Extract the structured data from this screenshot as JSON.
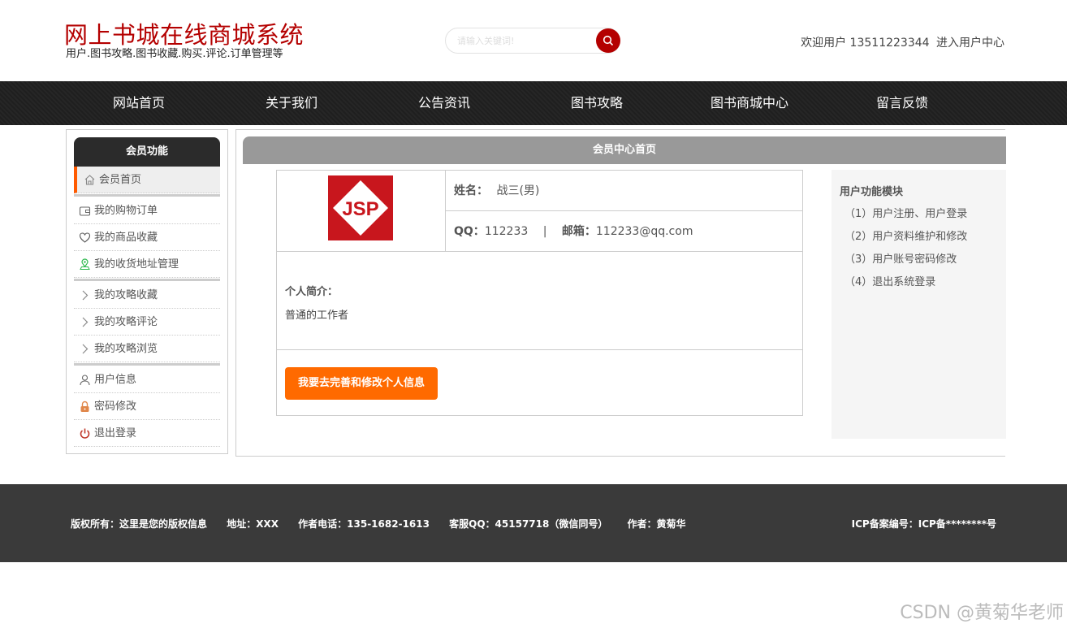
{
  "header": {
    "title": "网上书城在线商城系统",
    "subtitle": "用户.图书攻略.图书收藏.购买.评论.订单管理等",
    "search_placeholder": "请输入关键词!",
    "welcome_text": "欢迎用户 13511223344",
    "user_center_link": "进入用户中心"
  },
  "nav": {
    "items": [
      "网站首页",
      "关于我们",
      "公告资讯",
      "图书攻略",
      "图书商城中心",
      "留言反馈"
    ]
  },
  "sidebar": {
    "title": "会员功能",
    "items": [
      {
        "label": "会员首页",
        "icon": "home-icon"
      },
      {
        "label": "我的购物订单",
        "icon": "wallet-icon"
      },
      {
        "label": "我的商品收藏",
        "icon": "heart-icon"
      },
      {
        "label": "我的收货地址管理",
        "icon": "location-icon"
      },
      {
        "label": "我的攻略收藏",
        "icon": "chevron-right-icon"
      },
      {
        "label": "我的攻略评论",
        "icon": "chevron-right-icon"
      },
      {
        "label": "我的攻略浏览",
        "icon": "chevron-right-icon"
      },
      {
        "label": "用户信息",
        "icon": "user-icon"
      },
      {
        "label": "密码修改",
        "icon": "lock-icon"
      },
      {
        "label": "退出登录",
        "icon": "power-icon"
      }
    ]
  },
  "main": {
    "title": "会员中心首页",
    "avatar_text": "JSP",
    "name_label": "姓名：",
    "name_value": "战三(男)",
    "qq_label": "QQ：",
    "qq_value": "112233",
    "separator": "|",
    "email_label": "邮箱：",
    "email_value": "112233@qq.com",
    "intro_label": "个人简介：",
    "intro_text": "普通的工作者",
    "edit_button": "我要去完善和修改个人信息"
  },
  "functions": {
    "title": "用户功能模块",
    "items": [
      "（1）用户注册、用户登录",
      "（2）用户资料维护和修改",
      "（3）用户账号密码修改",
      "（4）退出系统登录"
    ]
  },
  "footer": {
    "copyright": "版权所有：这里是您的版权信息",
    "address": "地址：XXX",
    "phone": "作者电话：135-1682-1613",
    "qq": "客服QQ：45157718（微信同号）",
    "author": "作者：黄菊华",
    "icp": "ICP备案编号：ICP备********号"
  },
  "watermark": "CSDN @黄菊华老师",
  "colors": {
    "brand_red": "#b40000",
    "accent_orange": "#ff6a00",
    "nav_bg": "#222222",
    "footer_bg": "#3a3a3a"
  }
}
